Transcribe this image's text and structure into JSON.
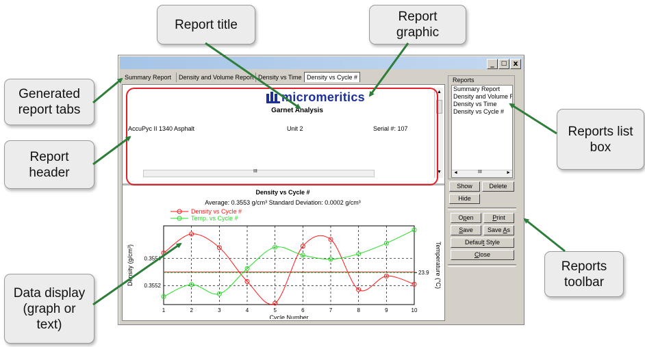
{
  "callouts": {
    "report_title": "Report title",
    "report_graphic_line1": "Report",
    "report_graphic_line2": "graphic",
    "generated_tabs_line1": "Generated",
    "generated_tabs_line2": "report tabs",
    "report_header_line1": "Report",
    "report_header_line2": "header",
    "reports_list_line1": "Reports list",
    "reports_list_line2": "box",
    "data_display_line1": "Data display",
    "data_display_line2": "(graph or",
    "data_display_line3": "text)",
    "reports_toolbar_line1": "Reports",
    "reports_toolbar_line2": "toolbar"
  },
  "window": {
    "minimize": "_",
    "maximize": "□",
    "close": "x"
  },
  "tabs": [
    "Summary Report",
    "Density and Volume Report",
    "Density vs Time",
    "Density vs Cycle #"
  ],
  "header": {
    "logo": "micromeritics",
    "title": "Garnet Analysis",
    "instrument": "AccuPyc II 1340 Asphalt",
    "unit": "Unit 2",
    "serial": "Serial #: 107",
    "hscroll_grip": "III"
  },
  "reports_panel": {
    "group_label": "Reports",
    "items": [
      "Summary Report",
      "Density and Volume Re",
      "Density vs Time",
      "Density vs Cycle #"
    ],
    "hscroll_grip": "III",
    "show": "Show",
    "delete": "Delete",
    "hide": "Hide"
  },
  "toolbar": {
    "open": "Open",
    "print": "Print",
    "save": "Save",
    "save_as": "Save As",
    "default_style": "Default Style",
    "close": "Close"
  },
  "chart_data": {
    "type": "line",
    "title": "Density vs Cycle #",
    "subtitle": "Average:  0.3553 g/cm³     Standard Deviation:  0.0002 g/cm³",
    "xlabel": "Cycle Number",
    "ylabel": "Density (g/cm³)",
    "y2label": "Temperature (°C)",
    "x": [
      1,
      2,
      3,
      4,
      5,
      6,
      7,
      8,
      9,
      10
    ],
    "xlim": [
      1,
      10
    ],
    "ylim": [
      0.35506,
      0.35564
    ],
    "y_ticks": [
      0.3552,
      0.3554
    ],
    "y2_ticks": [
      23.9
    ],
    "grid": true,
    "legend_position": "top-left",
    "series": [
      {
        "name": "Density vs Cycle #",
        "axis": "left",
        "color": "#ff1a1a",
        "values": [
          0.35544,
          0.35558,
          0.35548,
          0.35523,
          0.35507,
          0.35549,
          0.35554,
          0.35517,
          0.35527,
          0.35521
        ]
      },
      {
        "name": "Temp. vs Cycle #",
        "axis": "right",
        "color": "#22dd22",
        "values": [
          23.72,
          23.81,
          23.74,
          23.93,
          24.09,
          24.03,
          24.0,
          24.04,
          24.12,
          24.22
        ]
      }
    ],
    "reference_lines": [
      {
        "axis": "left",
        "value": 0.3553,
        "color": "#cc2222",
        "style": "solid"
      },
      {
        "axis": "right",
        "value": 23.9,
        "color": "#22bb22",
        "style": "dashed"
      }
    ],
    "x_ticks": [
      1,
      2,
      3,
      4,
      5,
      6,
      7,
      8,
      9,
      10
    ]
  }
}
